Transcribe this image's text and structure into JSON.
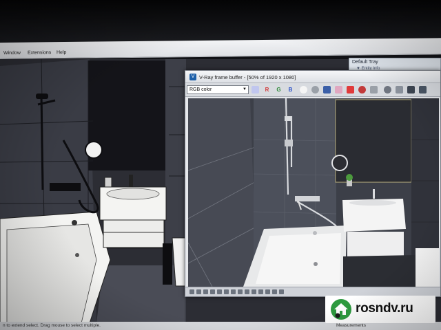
{
  "menu": {
    "items": [
      {
        "label": "Window"
      },
      {
        "label": "Extensions"
      },
      {
        "label": "Help"
      }
    ]
  },
  "tray": {
    "title": "Default Tray",
    "sub": "▼ Entity Info"
  },
  "vfb": {
    "title": "V-Ray frame buffer - [50% of 1920 x 1080]",
    "channel": "RGB color",
    "channel_buttons": [
      "R",
      "G",
      "B"
    ],
    "colors": {
      "r": "#d23a3a",
      "g": "#2e8a3a",
      "b": "#2d52c8",
      "accent": "#1d5fa8"
    }
  },
  "status": {
    "hint": "n to extend select. Drag mouse to select multiple.",
    "measurements": "Measurements"
  },
  "watermark": {
    "text": "rosndv.ru",
    "logo_color": "#2e9a3f"
  }
}
